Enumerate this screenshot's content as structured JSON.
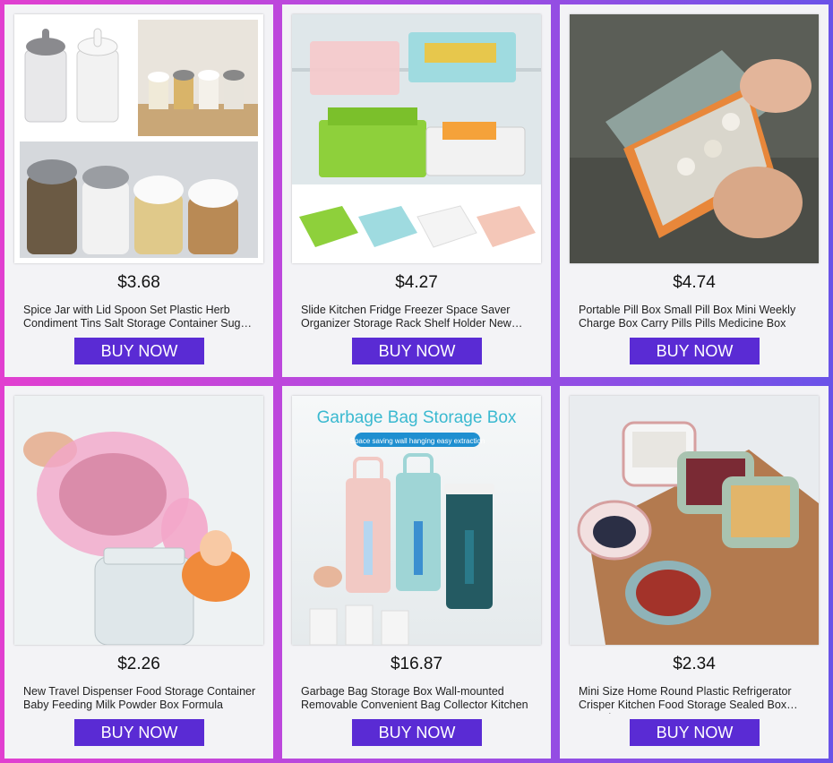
{
  "products": [
    {
      "price": "$3.68",
      "title": "Spice Jar with Lid Spoon Set Plastic Herb Condiment Tins Salt Storage Container Sugar Box",
      "image": "spice-jars-image",
      "buy_label": "BUY NOW"
    },
    {
      "price": "$4.27",
      "title": "Slide Kitchen Fridge Freezer Space Saver Organizer Storage Rack Shelf Holder New Drawer",
      "image": "fridge-drawer-image",
      "buy_label": "BUY NOW"
    },
    {
      "price": "$4.74",
      "title": "Portable Pill Box Small Pill Box Mini Weekly Charge Box Carry Pills Pills Medicine Box",
      "image": "pill-box-image",
      "buy_label": "BUY NOW"
    },
    {
      "price": "$2.26",
      "title": "New Travel Dispenser Food Storage Container Baby Feeding Milk Powder Box Formula",
      "image": "milk-powder-box-image",
      "buy_label": "BUY NOW"
    },
    {
      "price": "$16.87",
      "title": "Garbage Bag Storage Box Wall-mounted Removable Convenient Bag Collector Kitchen",
      "image": "garbage-bag-box-image",
      "buy_label": "BUY NOW",
      "image_heading": "Garbage Bag Storage Box",
      "image_subheading": "Space saving wall hanging easy extraction"
    },
    {
      "price": "$2.34",
      "title": "Mini Size Home Round Plastic Refrigerator Crisper Kitchen Food Storage Sealed Box Container",
      "image": "crisper-box-image",
      "buy_label": "BUY NOW"
    }
  ],
  "colors": {
    "button": "#5a2bd4",
    "card": "#f3f3f6"
  }
}
